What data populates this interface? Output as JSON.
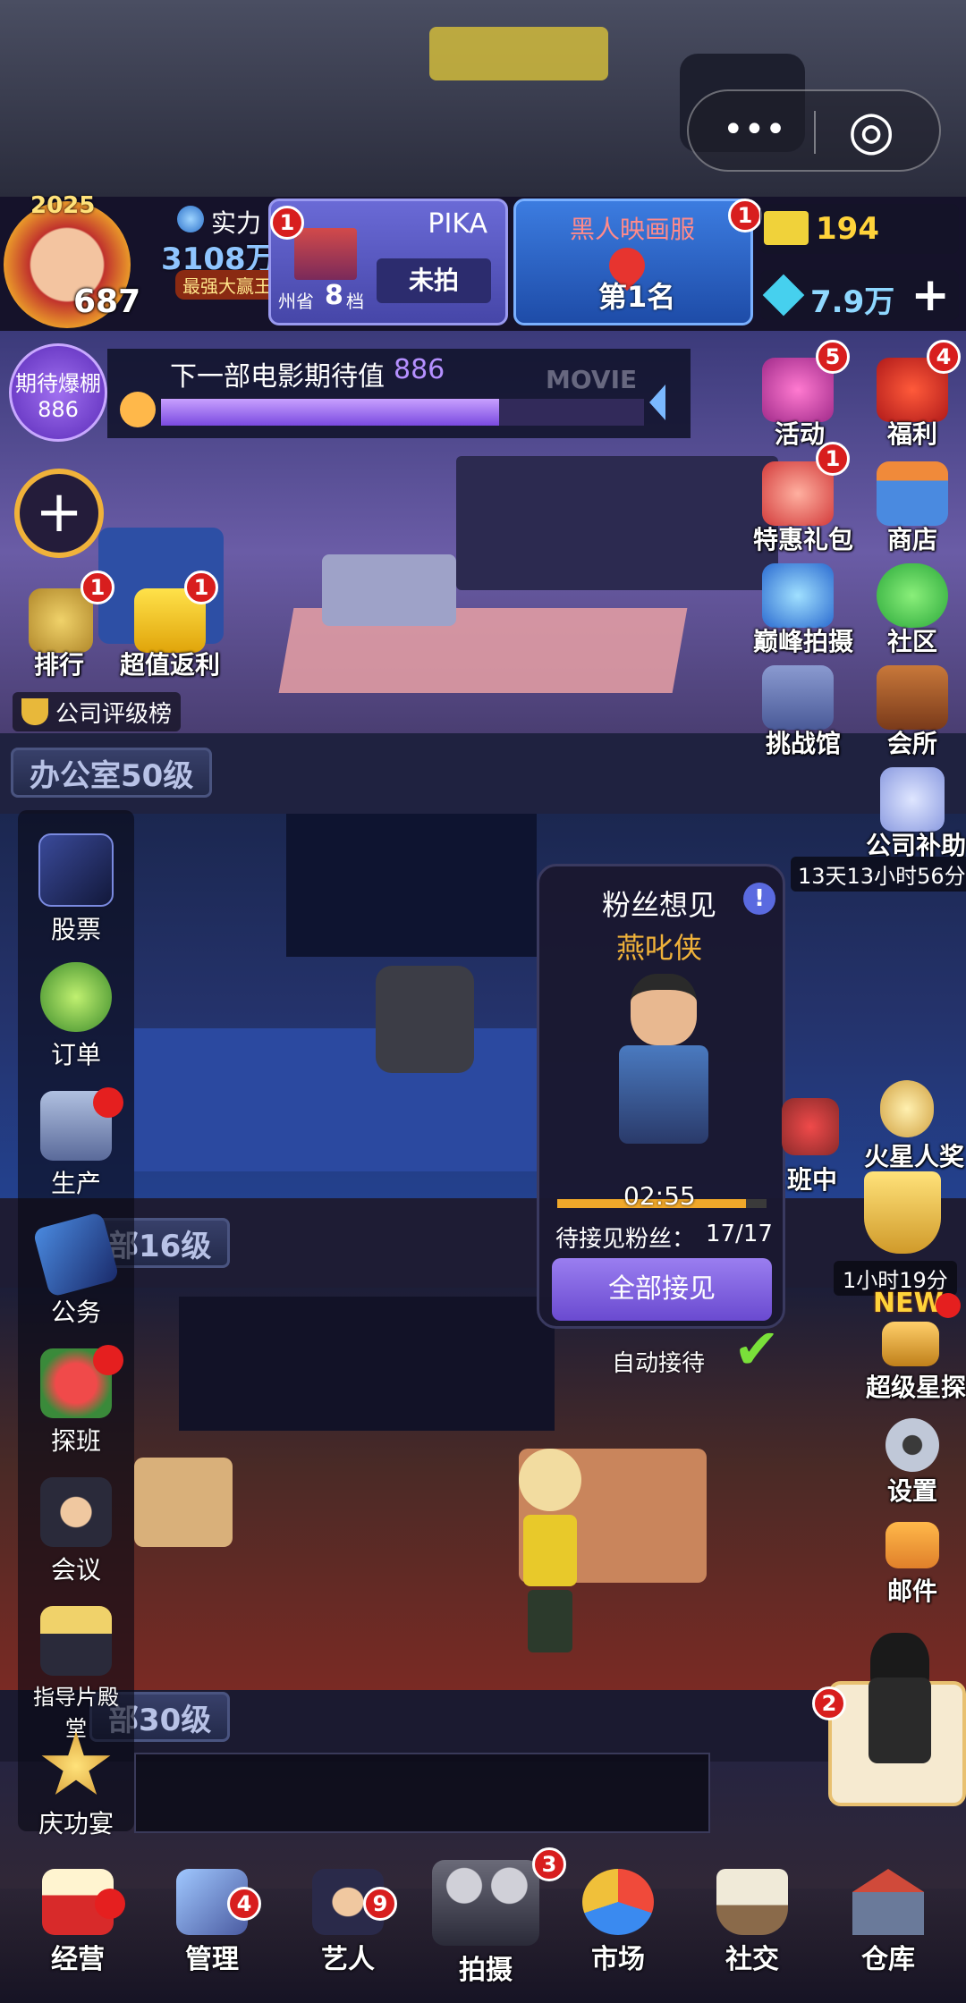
{
  "player": {
    "level": "687",
    "year_badge": "2025",
    "strength_label": "实力",
    "strength_value": "3108万",
    "title_badge": "最强大赢王"
  },
  "company": {
    "name": "PIKA",
    "province": "州省",
    "tier": "8",
    "tier_suffix": "档",
    "status": "未拍",
    "badge": "1"
  },
  "rank_card": {
    "server": "黑人映画服",
    "rank": "第1名",
    "badge": "1"
  },
  "currency": {
    "tickets": "194",
    "diamonds": "7.9万",
    "add": "+"
  },
  "anticipation": {
    "label": "期待爆棚",
    "value": "886",
    "text_prefix": "下一部电影期待值",
    "text_value": "886",
    "progress": 0.7,
    "sign": "MOVIE MAKE"
  },
  "top_left": {
    "rank_label": "排行",
    "rank_badge": "1",
    "rebate_label": "超值返利",
    "rebate_badge": "1",
    "rating_label": "公司评级榜",
    "add": "+"
  },
  "right_icons": [
    {
      "label": "活动",
      "badge": "5"
    },
    {
      "label": "福利",
      "badge": "4"
    },
    {
      "label": "特惠礼包",
      "badge": "1"
    },
    {
      "label": "商店",
      "badge": ""
    },
    {
      "label": "巅峰拍摄",
      "badge": ""
    },
    {
      "label": "社区",
      "badge": ""
    },
    {
      "label": "挑战馆",
      "badge": ""
    },
    {
      "label": "会所",
      "badge": ""
    },
    {
      "label": "公司补助",
      "badge": ""
    }
  ],
  "subsidy_timer": "13天13小时56分",
  "floors": {
    "office": "办公室50级",
    "dept2": "部16级",
    "dept3": "部30级"
  },
  "left_menu": [
    {
      "label": "股票"
    },
    {
      "label": "订单"
    },
    {
      "label": "生产"
    },
    {
      "label": "公务"
    },
    {
      "label": "探班"
    },
    {
      "label": "会议"
    },
    {
      "label": "指导片殿堂"
    },
    {
      "label": "庆功宴"
    }
  ],
  "fan_popup": {
    "title": "粉丝想见",
    "info": "!",
    "name": "燕叱侠",
    "timer": "02:55",
    "pending_label": "待接见粉丝：",
    "pending_value": "17/17",
    "button": "全部接见",
    "auto": "自动接待",
    "progress": 0.9
  },
  "side_right": {
    "visit": "班中",
    "mars_award": "火星人奖",
    "award_timer": "1小时19分",
    "new_tag": "NEW",
    "scout": "超级星探",
    "settings": "设置",
    "mail": "邮件",
    "assistant_badge": "2"
  },
  "nav": [
    {
      "label": "经营",
      "badge": "dot"
    },
    {
      "label": "管理",
      "badge": "4"
    },
    {
      "label": "艺人",
      "badge": "9"
    },
    {
      "label": "拍摄",
      "badge": "3"
    },
    {
      "label": "市场",
      "badge": ""
    },
    {
      "label": "社交",
      "badge": ""
    },
    {
      "label": "仓库",
      "badge": ""
    }
  ],
  "capsule": {
    "more": "•••",
    "close": "◎"
  }
}
